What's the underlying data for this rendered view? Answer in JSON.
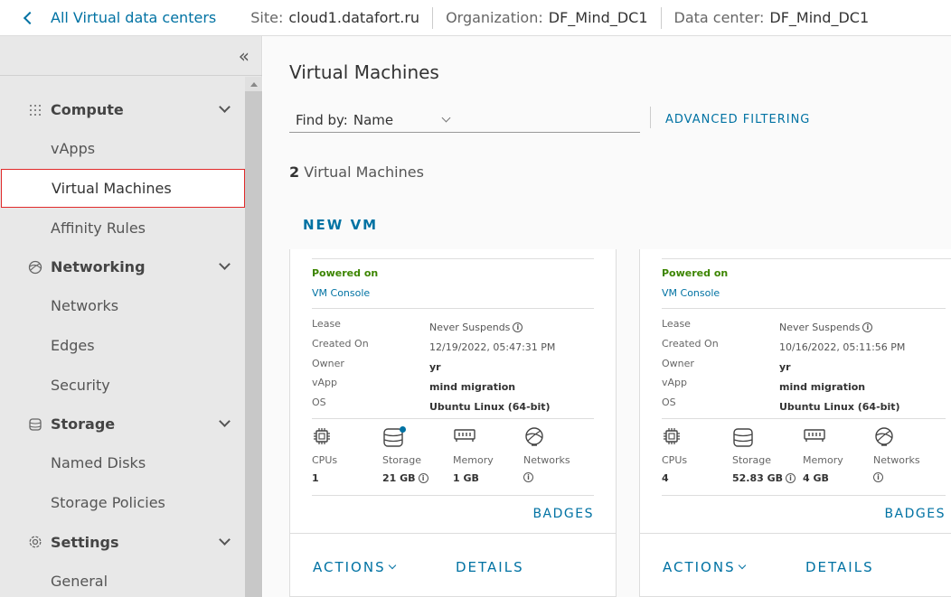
{
  "topbar": {
    "back_label": "All Virtual data centers",
    "site_label": "Site:",
    "site_value": "cloud1.datafort.ru",
    "org_label": "Organization:",
    "org_value": "DF_Mind_DC1",
    "dc_label": "Data center:",
    "dc_value": "DF_Mind_DC1"
  },
  "sidebar": {
    "collapse_glyph": "«",
    "groups": [
      {
        "label": "Compute",
        "icon": "grid-icon",
        "items": [
          "vApps",
          "Virtual Machines",
          "Affinity Rules"
        ]
      },
      {
        "label": "Networking",
        "icon": "network-icon",
        "items": [
          "Networks",
          "Edges",
          "Security"
        ]
      },
      {
        "label": "Storage",
        "icon": "storage-icon",
        "items": [
          "Named Disks",
          "Storage Policies"
        ]
      },
      {
        "label": "Settings",
        "icon": "gear-icon",
        "items": [
          "General"
        ]
      }
    ],
    "active_item": "Virtual Machines"
  },
  "main": {
    "title": "Virtual Machines",
    "find_by_label": "Find by:",
    "find_by_value": "Name",
    "advanced_filtering": "ADVANCED FILTERING",
    "count_number": "2",
    "count_label": "Virtual Machines",
    "new_vm": "NEW VM"
  },
  "card_labels": {
    "lease": "Lease",
    "created_on": "Created On",
    "owner": "Owner",
    "vapp": "vApp",
    "os": "OS",
    "cpus": "CPUs",
    "storage": "Storage",
    "memory": "Memory",
    "networks": "Networks",
    "badges": "BADGES",
    "actions": "ACTIONS",
    "details": "DETAILS",
    "vm_console": "VM Console"
  },
  "vms": [
    {
      "status": "Powered on",
      "lease": "Never Suspends",
      "created_on": "12/19/2022, 05:47:31 PM",
      "owner": "yr",
      "vapp": "mind migration",
      "os": "Ubuntu Linux (64-bit)",
      "cpus": "1",
      "storage": "21 GB",
      "memory": "1 GB"
    },
    {
      "status": "Powered on",
      "lease": "Never Suspends",
      "created_on": "10/16/2022, 05:11:56 PM",
      "owner": "yr",
      "vapp": "mind migration",
      "os": "Ubuntu Linux (64-bit)",
      "cpus": "4",
      "storage": "52.83 GB",
      "memory": "4 GB"
    }
  ],
  "colors": {
    "accent": "#0072a3",
    "powered_on": "#3c8500",
    "active_border": "#e02a2a"
  }
}
